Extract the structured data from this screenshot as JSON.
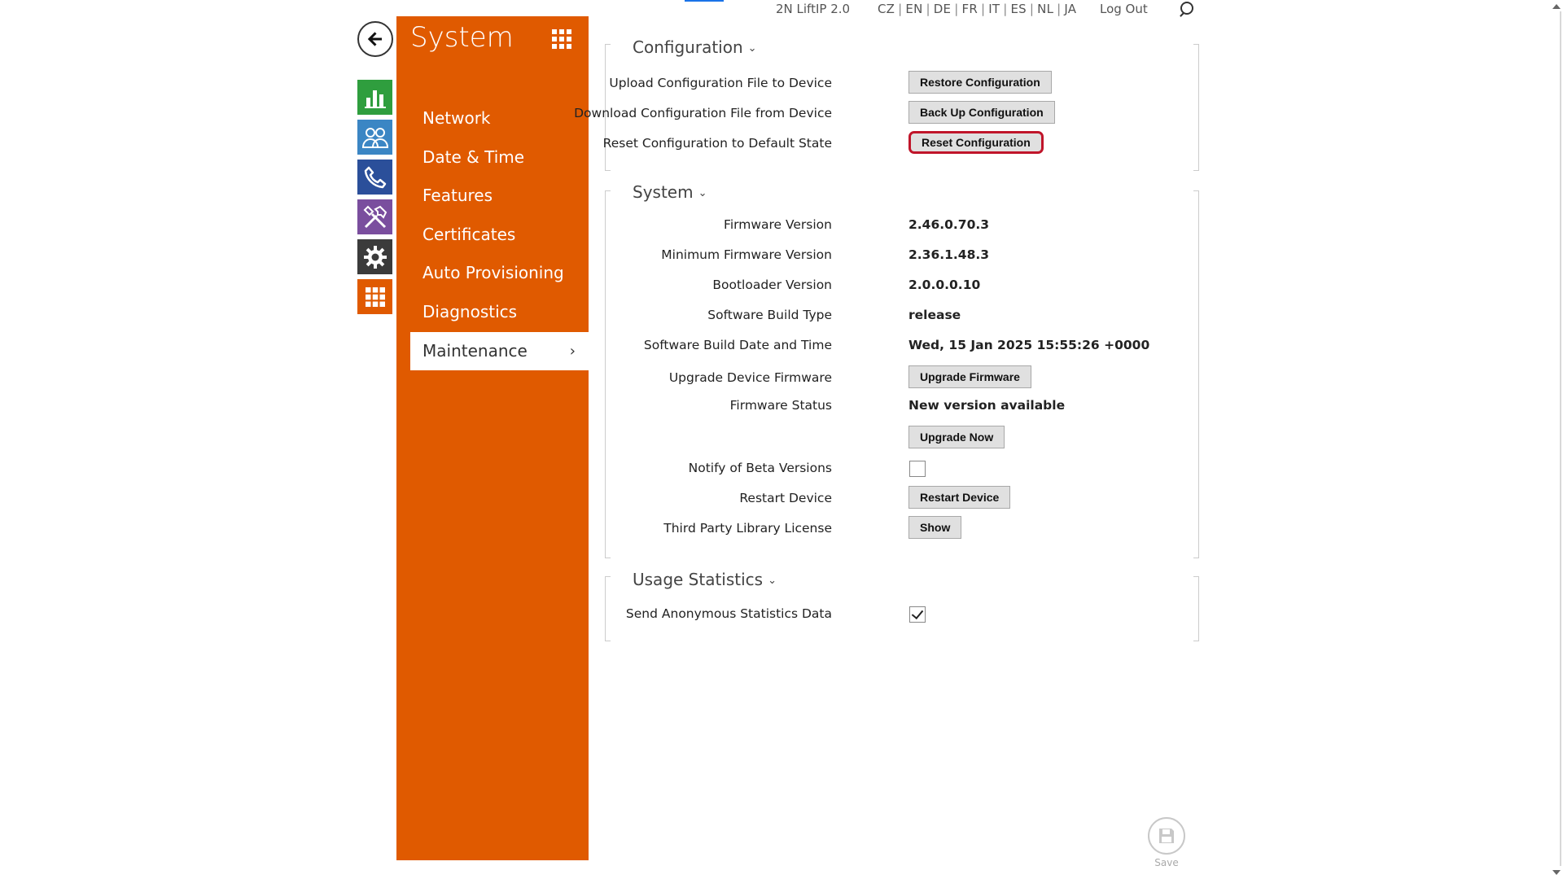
{
  "topbar": {
    "device_name": "2N LiftIP 2.0",
    "languages": [
      "CZ",
      "EN",
      "DE",
      "FR",
      "IT",
      "ES",
      "NL",
      "JA"
    ],
    "logout": "Log Out",
    "search_icon": "search-icon"
  },
  "rail": {
    "back_icon": "arrow-left-icon",
    "items": [
      {
        "name": "status",
        "icon": "bar-chart-icon",
        "color": "#2f9e3e"
      },
      {
        "name": "directory",
        "icon": "users-icon",
        "color": "#3b86c4"
      },
      {
        "name": "calls",
        "icon": "phone-icon",
        "color": "#2b4f9a"
      },
      {
        "name": "hardware",
        "icon": "tools-icon",
        "color": "#7a4e9e"
      },
      {
        "name": "services",
        "icon": "gear-icon",
        "color": "#3b3b3b"
      },
      {
        "name": "system",
        "icon": "grid-icon",
        "color": "#e05a00"
      }
    ]
  },
  "sidebar": {
    "title": "System",
    "accent": "#e05a00",
    "items": [
      {
        "label": "Network"
      },
      {
        "label": "Date & Time"
      },
      {
        "label": "Features"
      },
      {
        "label": "Certificates"
      },
      {
        "label": "Auto Provisioning"
      },
      {
        "label": "Diagnostics"
      },
      {
        "label": "Maintenance",
        "active": true
      }
    ]
  },
  "configuration": {
    "title": "Configuration",
    "upload_label": "Upload Configuration File to Device",
    "upload_button": "Restore Configuration",
    "download_label": "Download Configuration File from Device",
    "download_button": "Back Up Configuration",
    "reset_label": "Reset Configuration to Default State",
    "reset_button": "Reset Configuration"
  },
  "system": {
    "title": "System",
    "firmware_version_label": "Firmware Version",
    "firmware_version": "2.46.0.70.3",
    "min_firmware_label": "Minimum Firmware Version",
    "min_firmware": "2.36.1.48.3",
    "bootloader_label": "Bootloader Version",
    "bootloader": "2.0.0.0.10",
    "build_type_label": "Software Build Type",
    "build_type": "release",
    "build_date_label": "Software Build Date and Time",
    "build_date": "Wed, 15 Jan 2025 15:55:26 +0000",
    "upgrade_label": "Upgrade Device Firmware",
    "upgrade_button": "Upgrade Firmware",
    "firmware_status_label": "Firmware Status",
    "firmware_status": "New version available",
    "upgrade_now_button": "Upgrade Now",
    "beta_label": "Notify of Beta Versions",
    "beta_checked": false,
    "restart_label": "Restart Device",
    "restart_button": "Restart Device",
    "license_label": "Third Party Library License",
    "license_button": "Show"
  },
  "usage": {
    "title": "Usage Statistics",
    "send_label": "Send Anonymous Statistics Data",
    "send_checked": true
  },
  "save": {
    "label": "Save",
    "icon": "floppy-disk-icon"
  }
}
